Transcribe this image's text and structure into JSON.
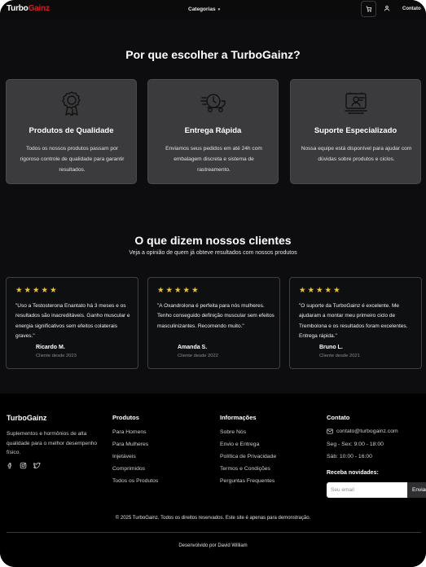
{
  "header": {
    "logo_part1": "Turbo",
    "logo_part2": "Gainz",
    "nav_categories": "Categorias",
    "nav_contact": "Contato"
  },
  "why": {
    "title": "Por que escolher a TurboGainz?",
    "cards": [
      {
        "icon": "award-ribbon-icon",
        "title": "Produtos de Qualidade",
        "desc": "Todos os nossos produtos passam por rigoroso controle de qualidade para garantir resultados."
      },
      {
        "icon": "fast-delivery-icon",
        "title": "Entrega Rápida",
        "desc": "Enviamos seus pedidos em até 24h com embalagem discreta e sistema de rastreamento."
      },
      {
        "icon": "support-chat-icon",
        "title": "Suporte Especializado",
        "desc": "Nossa equipe está disponível para ajudar com dúvidas sobre produtos e ciclos."
      }
    ]
  },
  "testimonials": {
    "title": "O que dizem nossos clientes",
    "subtitle": "Veja a opinião de quem já obteve resultados com nossos produtos",
    "stars": "★★★★★",
    "rating": 5,
    "items": [
      {
        "quote": "\"Uso a Testosterona Enantato há 3 meses e os resultados são inacreditáveis. Ganho muscular e energia significativos sem efeitos colaterais graves.\"",
        "name": "Ricardo M.",
        "since": "Cliente desde 2023"
      },
      {
        "quote": "\"A Oxandrolona é perfeita para nós mulheres. Tenho conseguido definição muscular sem efeitos masculinizantes. Recomendo muito.\"",
        "name": "Amanda S.",
        "since": "Cliente desde 2022"
      },
      {
        "quote": "\"O suporte da TurboGainz é excelente. Me ajudaram a montar meu primeiro ciclo de Trembolona e os resultados foram excelentes. Entrega rápida.\"",
        "name": "Bruno L.",
        "since": "Cliente desde 2021"
      }
    ]
  },
  "footer": {
    "brand": "TurboGainz",
    "description": "Suplementos e hormônios de alta qualidade para o melhor desempenho físico.",
    "products_title": "Produtos",
    "products": [
      "Para Homens",
      "Para Mulheres",
      "Injetáveis",
      "Comprimidos",
      "Todos os Produtos"
    ],
    "info_title": "Informações",
    "info": [
      "Sobre Nós",
      "Envio e Entrega",
      "Política de Privacidade",
      "Termos e Condições",
      "Perguntas Frequentes"
    ],
    "contact_title": "Contato",
    "email": "contato@turbogainz.com",
    "hours_weekday": "Seg - Sex: 9:00 - 18:00",
    "hours_saturday": "Sáb: 10:00 - 16:00",
    "newsletter_title": "Receba novidades:",
    "newsletter_placeholder": "Seu email",
    "newsletter_button": "Enviar",
    "copyright": "© 2025 TurboGainz. Todos os direitos reservados. Este site é apenas para demonstração.",
    "developer": "Desenvolvido por David William"
  },
  "colors": {
    "brand_red": "#d22020",
    "star_yellow": "#f5c518",
    "page_bg": "#0d0d0f",
    "card_bg": "#3b3b3d"
  }
}
